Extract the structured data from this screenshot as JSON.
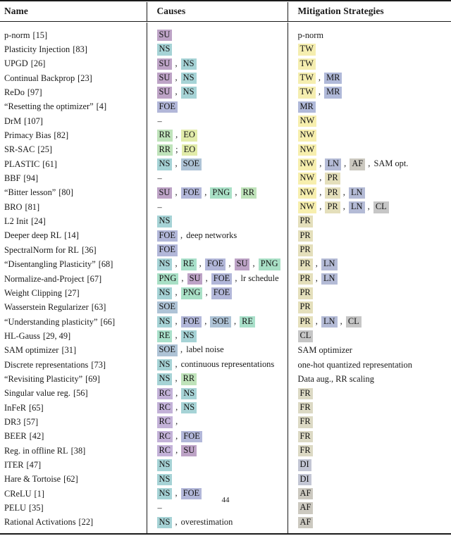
{
  "table": {
    "columns": [
      "Name",
      "Causes",
      "Mitigation Strategies"
    ],
    "tag_colors": {
      "SU": "#bda3c6",
      "NS": "#a6d3d6",
      "FOE": "#b2b7d9",
      "RR": "#bfe3ba",
      "EO": "#e2ecaa",
      "SOE": "#aec3d6",
      "PNG": "#a9e0c6",
      "RE": "#a9e0ca",
      "RC": "#c3b2d8",
      "TW": "#f5eeb0",
      "NW": "#f7efae",
      "MR": "#b0b9d9",
      "PR": "#e4dfbb",
      "LN": "#b4bbd6",
      "CL": "#c6c6c6",
      "AF": "#ccc9c0",
      "FR": "#dcd9c4",
      "DI": "#c3c6d4"
    },
    "rows": [
      {
        "name": "p-norm",
        "ref": "[15]",
        "causes": [
          {
            "t": "tag",
            "v": "SU"
          }
        ],
        "mitigation": [
          {
            "t": "text",
            "v": "p-norm"
          }
        ]
      },
      {
        "name": "Plasticity Injection",
        "ref": "[83]",
        "causes": [
          {
            "t": "tag",
            "v": "NS"
          }
        ],
        "mitigation": [
          {
            "t": "tag",
            "v": "TW"
          }
        ]
      },
      {
        "name": "UPGD",
        "ref": "[26]",
        "causes": [
          {
            "t": "tag",
            "v": "SU"
          },
          {
            "t": "sep",
            "v": ","
          },
          {
            "t": "tag",
            "v": "NS"
          }
        ],
        "mitigation": [
          {
            "t": "tag",
            "v": "TW"
          }
        ]
      },
      {
        "name": "Continual Backprop",
        "ref": "[23]",
        "causes": [
          {
            "t": "tag",
            "v": "SU"
          },
          {
            "t": "sep",
            "v": ","
          },
          {
            "t": "tag",
            "v": "NS"
          }
        ],
        "mitigation": [
          {
            "t": "tag",
            "v": "TW"
          },
          {
            "t": "sep",
            "v": ","
          },
          {
            "t": "tag",
            "v": "MR"
          }
        ]
      },
      {
        "name": "ReDo",
        "ref": "[97]",
        "causes": [
          {
            "t": "tag",
            "v": "SU"
          },
          {
            "t": "sep",
            "v": ","
          },
          {
            "t": "tag",
            "v": "NS"
          }
        ],
        "mitigation": [
          {
            "t": "tag",
            "v": "TW"
          },
          {
            "t": "sep",
            "v": ","
          },
          {
            "t": "tag",
            "v": "MR"
          }
        ]
      },
      {
        "name": "“Resetting the optimizer”",
        "ref": "[4]",
        "causes": [
          {
            "t": "tag",
            "v": "FOE"
          }
        ],
        "mitigation": [
          {
            "t": "tag",
            "v": "MR"
          }
        ]
      },
      {
        "name": "DrM",
        "ref": "[107]",
        "causes": [
          {
            "t": "dash",
            "v": "–"
          }
        ],
        "mitigation": [
          {
            "t": "tag",
            "v": "NW"
          }
        ]
      },
      {
        "name": "Primacy Bias",
        "ref": "[82]",
        "causes": [
          {
            "t": "tag",
            "v": "RR"
          },
          {
            "t": "sep",
            "v": ","
          },
          {
            "t": "tag",
            "v": "EO"
          }
        ],
        "mitigation": [
          {
            "t": "tag",
            "v": "NW"
          }
        ]
      },
      {
        "name": "SR-SAC",
        "ref": "[25]",
        "causes": [
          {
            "t": "tag",
            "v": "RR"
          },
          {
            "t": "sep",
            "v": ";"
          },
          {
            "t": "tag",
            "v": "EO"
          }
        ],
        "mitigation": [
          {
            "t": "tag",
            "v": "NW"
          }
        ]
      },
      {
        "name": "PLASTIC",
        "ref": "[61]",
        "causes": [
          {
            "t": "tag",
            "v": "NS"
          },
          {
            "t": "sep",
            "v": ","
          },
          {
            "t": "tag",
            "v": "SOE"
          }
        ],
        "mitigation": [
          {
            "t": "tag",
            "v": "NW"
          },
          {
            "t": "sep",
            "v": ","
          },
          {
            "t": "tag",
            "v": "LN"
          },
          {
            "t": "sep",
            "v": ","
          },
          {
            "t": "tag",
            "v": "AF"
          },
          {
            "t": "sep",
            "v": ","
          },
          {
            "t": "text",
            "v": "SAM opt."
          }
        ]
      },
      {
        "name": "BBF",
        "ref": "[94]",
        "causes": [
          {
            "t": "dash",
            "v": "–"
          }
        ],
        "mitigation": [
          {
            "t": "tag",
            "v": "NW"
          },
          {
            "t": "sep",
            "v": ","
          },
          {
            "t": "tag",
            "v": "PR"
          }
        ]
      },
      {
        "name": "“Bitter lesson”",
        "ref": "[80]",
        "causes": [
          {
            "t": "tag",
            "v": "SU"
          },
          {
            "t": "sep",
            "v": ","
          },
          {
            "t": "tag",
            "v": "FOE"
          },
          {
            "t": "sep",
            "v": ","
          },
          {
            "t": "tag",
            "v": "PNG"
          },
          {
            "t": "sep",
            "v": ","
          },
          {
            "t": "tag",
            "v": "RR"
          }
        ],
        "mitigation": [
          {
            "t": "tag",
            "v": "NW"
          },
          {
            "t": "sep",
            "v": ","
          },
          {
            "t": "tag",
            "v": "PR"
          },
          {
            "t": "sep",
            "v": ","
          },
          {
            "t": "tag",
            "v": "LN"
          }
        ]
      },
      {
        "name": "BRO",
        "ref": "[81]",
        "causes": [
          {
            "t": "dash",
            "v": "–"
          }
        ],
        "mitigation": [
          {
            "t": "tag",
            "v": "NW"
          },
          {
            "t": "sep",
            "v": ","
          },
          {
            "t": "tag",
            "v": "PR"
          },
          {
            "t": "sep",
            "v": ","
          },
          {
            "t": "tag",
            "v": "LN"
          },
          {
            "t": "sep",
            "v": ","
          },
          {
            "t": "tag",
            "v": "CL"
          }
        ]
      },
      {
        "name": "L2 Init",
        "ref": "[24]",
        "causes": [
          {
            "t": "tag",
            "v": "NS"
          }
        ],
        "mitigation": [
          {
            "t": "tag",
            "v": "PR"
          }
        ]
      },
      {
        "name": "Deeper deep RL",
        "ref": "[14]",
        "causes": [
          {
            "t": "tag",
            "v": "FOE"
          },
          {
            "t": "sep",
            "v": ","
          },
          {
            "t": "text",
            "v": "deep networks"
          }
        ],
        "mitigation": [
          {
            "t": "tag",
            "v": "PR"
          }
        ]
      },
      {
        "name": "SpectralNorm for RL",
        "ref": "[36]",
        "causes": [
          {
            "t": "tag",
            "v": "FOE"
          }
        ],
        "mitigation": [
          {
            "t": "tag",
            "v": "PR"
          }
        ]
      },
      {
        "name": "“Disentangling Plasticity”",
        "ref": "[68]",
        "causes": [
          {
            "t": "tag",
            "v": "NS"
          },
          {
            "t": "sep",
            "v": ","
          },
          {
            "t": "tag",
            "v": "RE"
          },
          {
            "t": "sep",
            "v": ","
          },
          {
            "t": "tag",
            "v": "FOE"
          },
          {
            "t": "sep",
            "v": ","
          },
          {
            "t": "tag",
            "v": "SU"
          },
          {
            "t": "sep",
            "v": ","
          },
          {
            "t": "tag",
            "v": "PNG"
          }
        ],
        "mitigation": [
          {
            "t": "tag",
            "v": "PR"
          },
          {
            "t": "sep",
            "v": ","
          },
          {
            "t": "tag",
            "v": "LN"
          }
        ]
      },
      {
        "name": "Normalize-and-Project",
        "ref": "[67]",
        "causes": [
          {
            "t": "tag",
            "v": "PNG"
          },
          {
            "t": "sep",
            "v": ","
          },
          {
            "t": "tag",
            "v": "SU"
          },
          {
            "t": "sep",
            "v": ","
          },
          {
            "t": "tag",
            "v": "FOE"
          },
          {
            "t": "sep",
            "v": ","
          },
          {
            "t": "text",
            "v": "lr schedule"
          }
        ],
        "mitigation": [
          {
            "t": "tag",
            "v": "PR"
          },
          {
            "t": "sep",
            "v": ","
          },
          {
            "t": "tag",
            "v": "LN"
          }
        ]
      },
      {
        "name": "Weight Clipping",
        "ref": "[27]",
        "causes": [
          {
            "t": "tag",
            "v": "NS"
          },
          {
            "t": "sep",
            "v": ","
          },
          {
            "t": "tag",
            "v": "PNG"
          },
          {
            "t": "sep",
            "v": ","
          },
          {
            "t": "tag",
            "v": "FOE"
          }
        ],
        "mitigation": [
          {
            "t": "tag",
            "v": "PR"
          }
        ]
      },
      {
        "name": "Wasserstein Regularizer",
        "ref": "[63]",
        "causes": [
          {
            "t": "tag",
            "v": "SOE"
          }
        ],
        "mitigation": [
          {
            "t": "tag",
            "v": "PR"
          }
        ]
      },
      {
        "name": "“Understanding plasticity”",
        "ref": "[66]",
        "causes": [
          {
            "t": "tag",
            "v": "NS"
          },
          {
            "t": "sep",
            "v": ","
          },
          {
            "t": "tag",
            "v": "FOE"
          },
          {
            "t": "sep",
            "v": ","
          },
          {
            "t": "tag",
            "v": "SOE"
          },
          {
            "t": "sep",
            "v": ","
          },
          {
            "t": "tag",
            "v": "RE"
          }
        ],
        "mitigation": [
          {
            "t": "tag",
            "v": "PR"
          },
          {
            "t": "sep",
            "v": ","
          },
          {
            "t": "tag",
            "v": "LN"
          },
          {
            "t": "sep",
            "v": ","
          },
          {
            "t": "tag",
            "v": "CL"
          }
        ]
      },
      {
        "name": "HL-Gauss",
        "ref": "[29, 49]",
        "causes": [
          {
            "t": "tag",
            "v": "RE"
          },
          {
            "t": "sep",
            "v": ","
          },
          {
            "t": "tag",
            "v": "NS"
          }
        ],
        "mitigation": [
          {
            "t": "tag",
            "v": "CL"
          }
        ]
      },
      {
        "name": "SAM optimizer",
        "ref": "[31]",
        "causes": [
          {
            "t": "tag",
            "v": "SOE"
          },
          {
            "t": "sep",
            "v": ","
          },
          {
            "t": "text",
            "v": "label noise"
          }
        ],
        "mitigation": [
          {
            "t": "text",
            "v": "SAM optimizer"
          }
        ]
      },
      {
        "name": "Discrete representations",
        "ref": "[73]",
        "causes": [
          {
            "t": "tag",
            "v": "NS"
          },
          {
            "t": "sep",
            "v": ","
          },
          {
            "t": "text",
            "v": "continuous representations"
          }
        ],
        "mitigation": [
          {
            "t": "text",
            "v": "one-hot quantized representation"
          }
        ]
      },
      {
        "name": "“Revisiting Plasticity”",
        "ref": "[69]",
        "causes": [
          {
            "t": "tag",
            "v": "NS"
          },
          {
            "t": "sep",
            "v": ","
          },
          {
            "t": "tag",
            "v": "RR"
          }
        ],
        "mitigation": [
          {
            "t": "text",
            "v": "Data aug., RR scaling"
          }
        ]
      },
      {
        "name": "Singular value reg.",
        "ref": "[56]",
        "causes": [
          {
            "t": "tag",
            "v": "RC"
          },
          {
            "t": "sep",
            "v": ","
          },
          {
            "t": "tag",
            "v": "NS"
          }
        ],
        "mitigation": [
          {
            "t": "tag",
            "v": "FR"
          }
        ]
      },
      {
        "name": "InFeR",
        "ref": "[65]",
        "causes": [
          {
            "t": "tag",
            "v": "RC"
          },
          {
            "t": "sep",
            "v": ","
          },
          {
            "t": "tag",
            "v": "NS"
          }
        ],
        "mitigation": [
          {
            "t": "tag",
            "v": "FR"
          }
        ]
      },
      {
        "name": "DR3",
        "ref": "[57]",
        "causes": [
          {
            "t": "tag",
            "v": "RC"
          },
          {
            "t": "sep",
            "v": ","
          }
        ],
        "mitigation": [
          {
            "t": "tag",
            "v": "FR"
          }
        ]
      },
      {
        "name": "BEER",
        "ref": "[42]",
        "causes": [
          {
            "t": "tag",
            "v": "RC"
          },
          {
            "t": "sep",
            "v": ","
          },
          {
            "t": "tag",
            "v": "FOE"
          }
        ],
        "mitigation": [
          {
            "t": "tag",
            "v": "FR"
          }
        ]
      },
      {
        "name": "Reg. in offline RL",
        "ref": "[38]",
        "causes": [
          {
            "t": "tag",
            "v": "RC"
          },
          {
            "t": "sep",
            "v": ","
          },
          {
            "t": "tag",
            "v": "SU"
          }
        ],
        "mitigation": [
          {
            "t": "tag",
            "v": "FR"
          }
        ]
      },
      {
        "name": "ITER",
        "ref": "[47]",
        "causes": [
          {
            "t": "tag",
            "v": "NS"
          }
        ],
        "mitigation": [
          {
            "t": "tag",
            "v": "DI"
          }
        ]
      },
      {
        "name": "Hare & Tortoise",
        "ref": "[62]",
        "causes": [
          {
            "t": "tag",
            "v": "NS"
          }
        ],
        "mitigation": [
          {
            "t": "tag",
            "v": "DI"
          }
        ]
      },
      {
        "name": "CReLU",
        "ref": "[1]",
        "causes": [
          {
            "t": "tag",
            "v": "NS"
          },
          {
            "t": "sep",
            "v": ","
          },
          {
            "t": "tag",
            "v": "FOE"
          }
        ],
        "mitigation": [
          {
            "t": "tag",
            "v": "AF"
          }
        ]
      },
      {
        "name": "PELU",
        "ref": "[35]",
        "causes": [
          {
            "t": "dash",
            "v": "–"
          }
        ],
        "mitigation": [
          {
            "t": "tag",
            "v": "AF"
          }
        ]
      },
      {
        "name": "Rational Activations",
        "ref": "[22]",
        "causes": [
          {
            "t": "tag",
            "v": "NS"
          },
          {
            "t": "sep",
            "v": ","
          },
          {
            "t": "text",
            "v": "overestimation"
          }
        ],
        "mitigation": [
          {
            "t": "tag",
            "v": "AF"
          }
        ]
      }
    ]
  },
  "footer": {
    "page_number": "44"
  }
}
